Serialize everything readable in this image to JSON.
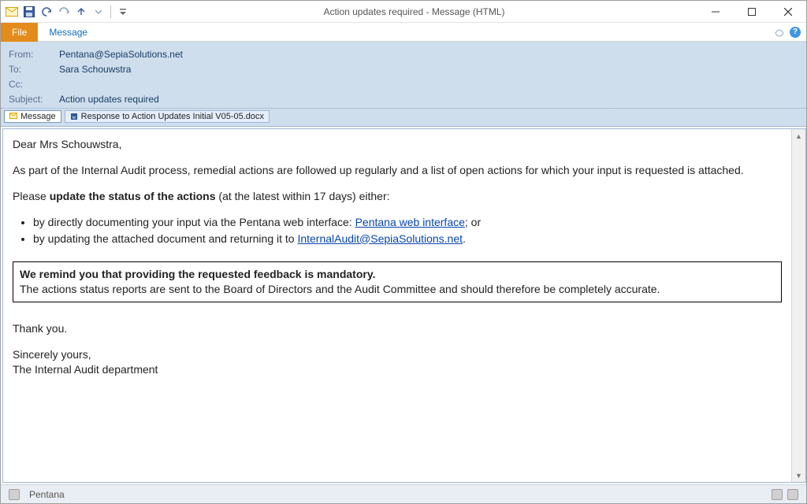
{
  "window": {
    "title": "Action updates required - Message (HTML)"
  },
  "ribbon": {
    "file": "File",
    "message": "Message"
  },
  "header": {
    "from_label": "From:",
    "from_value": "Pentana@SepiaSolutions.net",
    "to_label": "To:",
    "to_value": "Sara Schouwstra",
    "cc_label": "Cc:",
    "cc_value": "",
    "subject_label": "Subject:",
    "subject_value": "Action updates required"
  },
  "attachments": {
    "message_tab": "Message",
    "file_tab": "Response to Action Updates Initial V05-05.docx"
  },
  "body": {
    "greeting": "Dear Mrs Schouwstra,",
    "intro": "As part of the Internal Audit process, remedial actions are followed up regularly and a list of open actions for which your input is requested is attached.",
    "please_prefix": "Please ",
    "please_bold": "update the status of the actions",
    "please_suffix": " (at the latest within 17 days) either:",
    "bullet1_pre": "by directly documenting your input via the Pentana web interface: ",
    "bullet1_link": "Pentana web interface",
    "bullet1_post": "; or",
    "bullet2_pre": "by updating the attached document and returning it to ",
    "bullet2_link": "InternalAudit@SepiaSolutions.net",
    "bullet2_post": ".",
    "reminder_bold": "We remind you that providing the requested feedback is mandatory.",
    "reminder_text": "The actions status reports are sent to the Board of Directors and the Audit Committee and should therefore be completely accurate.",
    "thanks": "Thank you.",
    "closing": "Sincerely yours,",
    "signature": "The Internal Audit department"
  },
  "status": {
    "sender_name": "Pentana"
  }
}
